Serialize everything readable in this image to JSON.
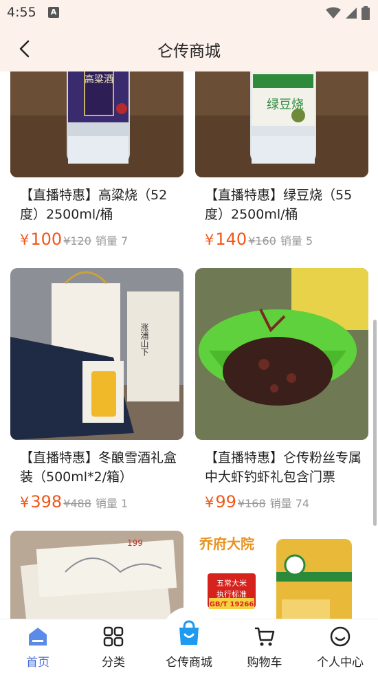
{
  "status_bar": {
    "time": "4:55",
    "notification_letter": "A"
  },
  "header": {
    "title": "仑传商城"
  },
  "products": [
    {
      "title": "【直播特惠】高粱烧（52度）2500ml/桶",
      "price_symbol": "¥",
      "price": "100",
      "original_price": "¥120",
      "sales": "销量 7",
      "image": "sorghum-liquor-bottle",
      "label_text": "高粱酒"
    },
    {
      "title": "【直播特惠】绿豆烧（55度）2500ml/桶",
      "price_symbol": "¥",
      "price": "140",
      "original_price": "¥160",
      "sales": "销量 5",
      "image": "mung-bean-liquor-bottle",
      "label_text": "绿豆烧"
    },
    {
      "title": "【直播特惠】冬酿雪酒礼盒装（500ml*2/箱）",
      "price_symbol": "¥",
      "price": "398",
      "original_price": "¥488",
      "sales": "销量 1",
      "image": "gift-box-liquor",
      "label_text": "涨浦山下"
    },
    {
      "title": "【直播特惠】仑传粉丝专属中大虾钓虾礼包含门票",
      "price_symbol": "¥",
      "price": "99",
      "original_price": "¥168",
      "sales": "销量 74",
      "image": "crayfish-bucket"
    },
    {
      "title": "",
      "image": "ticket-cards",
      "label_text": "199"
    },
    {
      "title": "",
      "image": "rice-bag",
      "brand_text": "乔府大院",
      "tag1": "五常大米",
      "tag2": "执行标准",
      "tag3": "GB/T 19266"
    }
  ],
  "bottom_nav": [
    {
      "label": "首页",
      "icon": "home-icon",
      "active": true
    },
    {
      "label": "分类",
      "icon": "grid-icon",
      "active": false
    },
    {
      "label": "仑传商城",
      "icon": "shopping-bag-icon",
      "active": false
    },
    {
      "label": "购物车",
      "icon": "cart-icon",
      "active": false
    },
    {
      "label": "个人中心",
      "icon": "smile-icon",
      "active": false
    }
  ],
  "colors": {
    "accent": "#f2571a",
    "header_bg": "#fdf1ec",
    "nav_active": "#4a6fd9",
    "shop_icon": "#1e9af0"
  }
}
